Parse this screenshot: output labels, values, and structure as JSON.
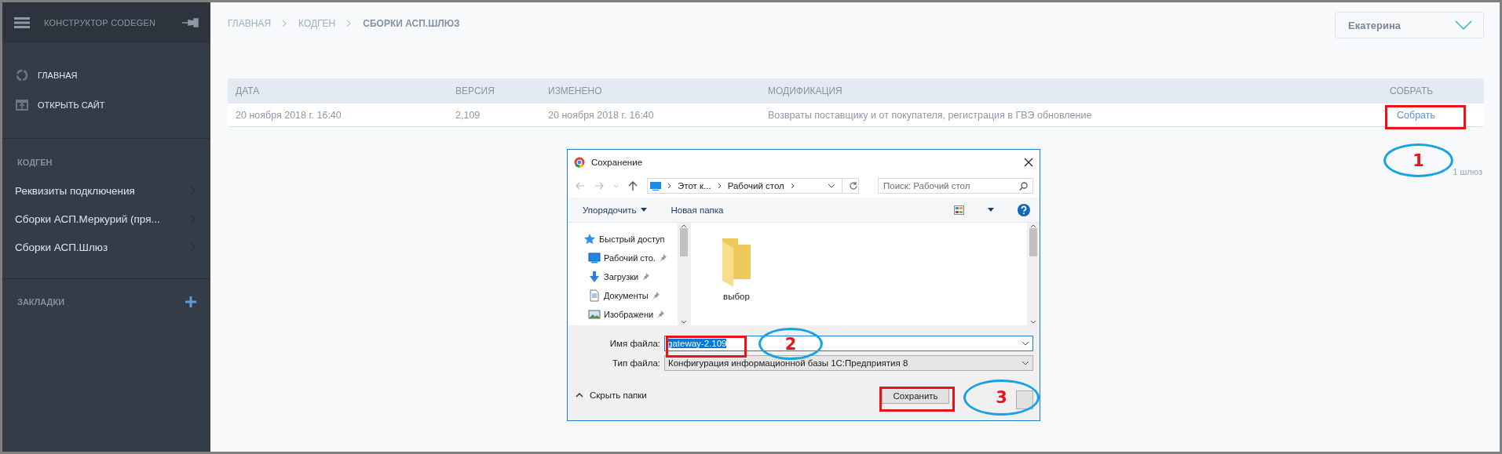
{
  "sidebar": {
    "title": "КОНСТРУКТОР CODEGEN",
    "nav": [
      {
        "label": "ГЛАВНАЯ"
      },
      {
        "label": "ОТКРЫТЬ САЙТ"
      }
    ],
    "section": "КОДГЕН",
    "items": [
      {
        "label": "Реквизиты подключения"
      },
      {
        "label": "Сборки АСП.Меркурий (пря..."
      },
      {
        "label": "Сборки АСП.Шлюз"
      }
    ],
    "bookmarks": "ЗАКЛАДКИ"
  },
  "breadcrumb": [
    {
      "label": "ГЛАВНАЯ",
      "current": false
    },
    {
      "label": "КОДГЕН",
      "current": false
    },
    {
      "label": "СБОРКИ АСП.ШЛЮЗ",
      "current": true
    }
  ],
  "user": "Екатерина",
  "table": {
    "columns": [
      "ДАТА",
      "ВЕРСИЯ",
      "ИЗМЕНЕНО",
      "МОДИФИКАЦИЯ",
      "СОБРАТЬ"
    ],
    "rows": [
      {
        "cells": [
          "20 ноября 2018 г. 16:40",
          "2,109",
          "20 ноября 2018 г. 16:40",
          "Возвраты поставщику и от покупателя, регистрация в ГВЭ обновление"
        ],
        "action": "Собрать"
      }
    ]
  },
  "count": "1 шлюз",
  "dialog": {
    "title": "Сохранение",
    "address": [
      "Этот к...",
      "Рабочий стол"
    ],
    "search_placeholder": "Поиск: Рабочий стол",
    "toolbar": [
      "Упорядочить",
      "Новая папка"
    ],
    "nav": [
      {
        "label": "Быстрый доступ",
        "pinned": false
      },
      {
        "label": "Рабочий сто.",
        "pinned": true
      },
      {
        "label": "Загрузки",
        "pinned": true
      },
      {
        "label": "Документы",
        "pinned": true
      },
      {
        "label": "Изображени",
        "pinned": true
      }
    ],
    "files": [
      "выбор"
    ],
    "filename_label": "Имя файла:",
    "filename": "gateway-2.109",
    "filename_selected": true,
    "filetype_label": "Тип файла:",
    "filetype": "Конфигурация информационной базы 1С:Предприятия 8",
    "hide_folders": "Скрыть папки",
    "save": "Сохранить"
  },
  "annotations": [
    {
      "label": "1"
    },
    {
      "label": "2"
    },
    {
      "label": "3"
    }
  ]
}
